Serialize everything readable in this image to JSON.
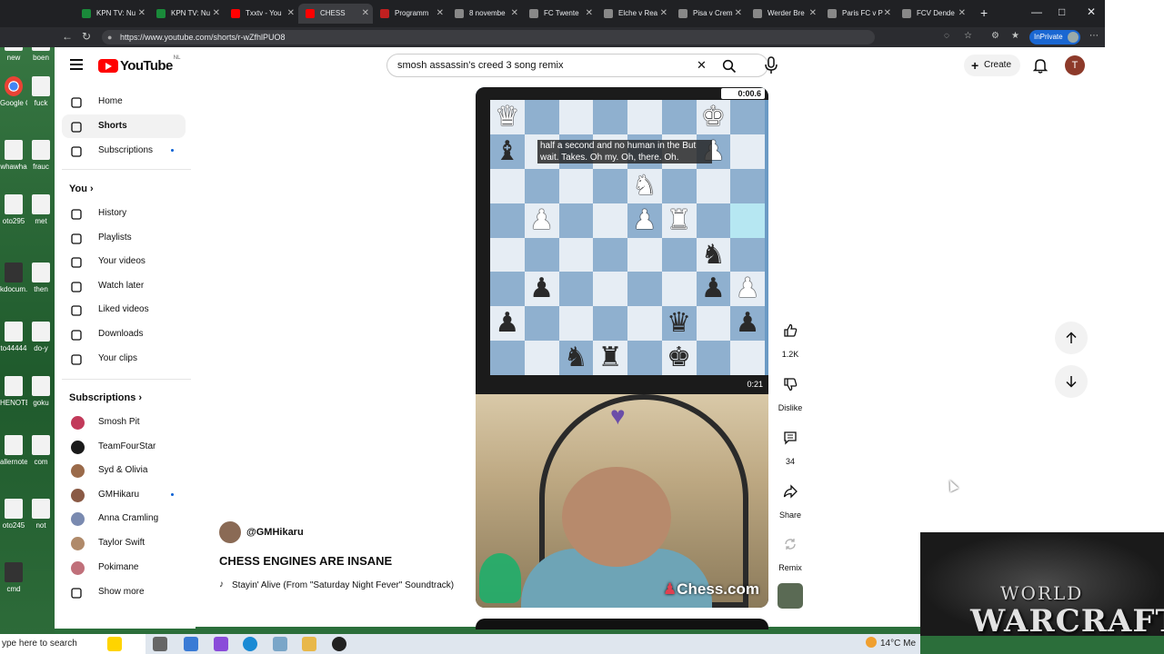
{
  "desktop": {
    "icons": [
      "new",
      "boen",
      "Google Chrome",
      "fuck",
      "whawha",
      "frauc",
      "oto295",
      "met",
      "kdocum...",
      "then",
      "to44444",
      "do-y",
      "HENOTE",
      "goku",
      "allernote",
      "com",
      "oto245",
      "not",
      "cmd"
    ]
  },
  "tabs": [
    {
      "label": "KPN TV: Nu",
      "color": "#1a8a3a"
    },
    {
      "label": "KPN TV: Nu",
      "color": "#1a8a3a"
    },
    {
      "label": "Txxtv - You",
      "color": "#ff0000"
    },
    {
      "label": "CHESS",
      "color": "#ff0000"
    },
    {
      "label": "Programm",
      "color": "#c02020"
    },
    {
      "label": "8 novembe",
      "color": "#888888"
    },
    {
      "label": "FC Twente",
      "color": "#888888"
    },
    {
      "label": "Elche v Rea",
      "color": "#888888"
    },
    {
      "label": "Pisa v Crem",
      "color": "#888888"
    },
    {
      "label": "Werder Bre",
      "color": "#888888"
    },
    {
      "label": "Paris FC v P",
      "color": "#888888"
    },
    {
      "label": "FCV Dende",
      "color": "#888888"
    }
  ],
  "address": {
    "url": "https://www.youtube.com/shorts/r-wZfhlPUO8",
    "inprivate": "InPrivate"
  },
  "header": {
    "logo": "YouTube",
    "region": "NL",
    "search_value": "smosh assassin's creed 3 song remix",
    "create_label": "Create",
    "avatar_letter": "T"
  },
  "sidebar": {
    "main": [
      {
        "label": "Home",
        "icon": "home-icon"
      },
      {
        "label": "Shorts",
        "icon": "shorts-icon"
      },
      {
        "label": "Subscriptions",
        "icon": "subscriptions-icon"
      }
    ],
    "you_heading": "You",
    "you": [
      {
        "label": "History",
        "icon": "history-icon"
      },
      {
        "label": "Playlists",
        "icon": "playlists-icon"
      },
      {
        "label": "Your videos",
        "icon": "your-videos-icon"
      },
      {
        "label": "Watch later",
        "icon": "watch-later-icon"
      },
      {
        "label": "Liked videos",
        "icon": "liked-videos-icon"
      },
      {
        "label": "Downloads",
        "icon": "downloads-icon"
      },
      {
        "label": "Your clips",
        "icon": "clips-icon"
      }
    ],
    "subs_heading": "Subscriptions",
    "subs": [
      {
        "label": "Smosh Pit",
        "color": "#c23a5a"
      },
      {
        "label": "TeamFourStar",
        "color": "#1a1a1a"
      },
      {
        "label": "Syd & Olivia",
        "color": "#9a6a4a"
      },
      {
        "label": "GMHikaru",
        "color": "#8a5a45"
      },
      {
        "label": "Anna Cramling",
        "color": "#7a8ab0"
      },
      {
        "label": "Taylor Swift",
        "color": "#b08a6a"
      },
      {
        "label": "Pokimane",
        "color": "#c0707a"
      }
    ],
    "show_more": "Show more"
  },
  "short": {
    "timer_top": "0:00.6",
    "caption": "half a second and no human in the But wait. Takes. Oh my. Oh, there. Oh.",
    "timer_bottom": "0:21",
    "brand": "Chess.com",
    "channel": "@GMHikaru",
    "title": "CHESS ENGINES ARE INSANE",
    "song": "Stayin' Alive (From \"Saturday Night Fever\" Soundtrack)"
  },
  "actions": {
    "likes": "1.2K",
    "dislike": "Dislike",
    "comments": "34",
    "share": "Share",
    "remix": "Remix"
  },
  "overlay": {
    "line1": "WORLD",
    "line2": "WARCRAFT"
  },
  "taskbar": {
    "search_placeholder": "ype here to search",
    "temperature": "14°C",
    "weather_text": "Me"
  }
}
